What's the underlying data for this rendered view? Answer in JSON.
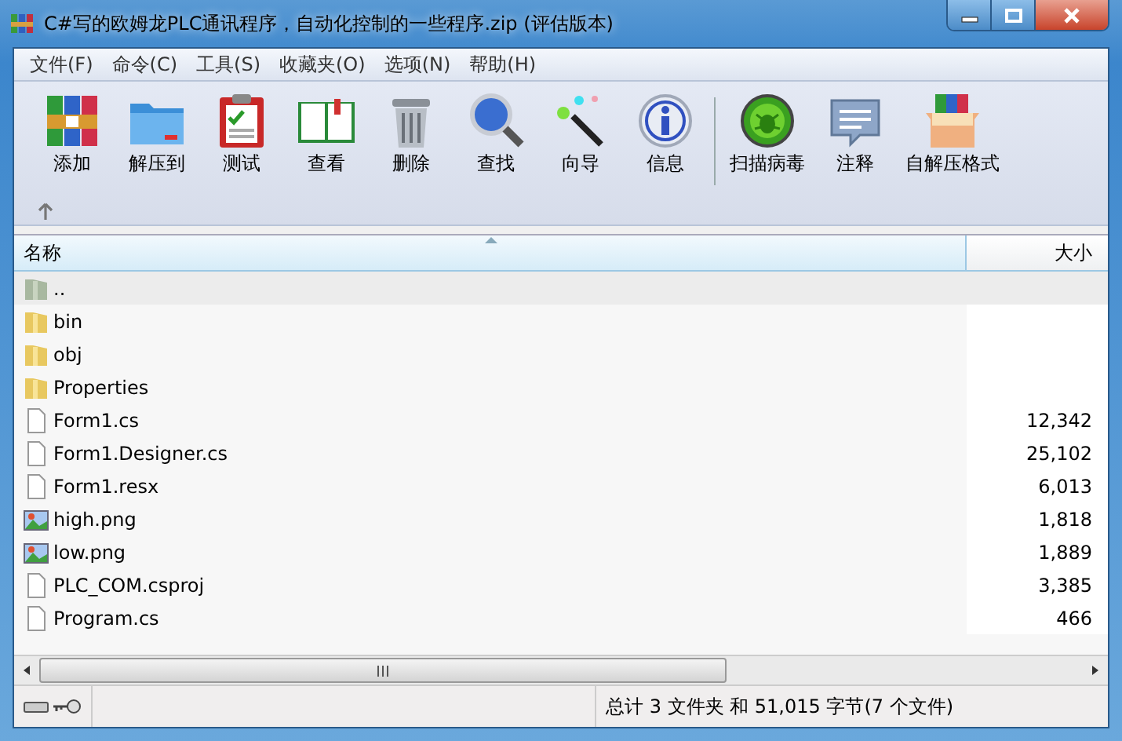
{
  "window": {
    "title": "C#写的欧姆龙PLC通讯程序，自动化控制的一些程序.zip (评估版本)"
  },
  "menu": [
    "文件(F)",
    "命令(C)",
    "工具(S)",
    "收藏夹(O)",
    "选项(N)",
    "帮助(H)"
  ],
  "toolbar": [
    {
      "label": "添加",
      "kind": "add"
    },
    {
      "label": "解压到",
      "kind": "extract"
    },
    {
      "label": "测试",
      "kind": "test"
    },
    {
      "label": "查看",
      "kind": "view"
    },
    {
      "label": "删除",
      "kind": "delete"
    },
    {
      "label": "查找",
      "kind": "find"
    },
    {
      "label": "向导",
      "kind": "wizard"
    },
    {
      "label": "信息",
      "kind": "info"
    },
    {
      "kind": "separator"
    },
    {
      "label": "扫描病毒",
      "kind": "virus"
    },
    {
      "label": "注释",
      "kind": "comment"
    },
    {
      "label": "自解压格式",
      "kind": "sfx"
    }
  ],
  "columns": [
    "名称",
    "大小"
  ],
  "rows": [
    {
      "name": "..",
      "kind": "parent",
      "selected": true
    },
    {
      "name": "bin",
      "kind": "folder",
      "selected": false
    },
    {
      "name": "obj",
      "kind": "folder",
      "selected": false
    },
    {
      "name": "Properties",
      "kind": "folder",
      "selected": false
    },
    {
      "name": "Form1.cs",
      "kind": "file",
      "size": "12,342",
      "selected": false
    },
    {
      "name": "Form1.Designer.cs",
      "kind": "file",
      "size": "25,102",
      "selected": false
    },
    {
      "name": "Form1.resx",
      "kind": "file",
      "size": "6,013",
      "selected": false
    },
    {
      "name": "high.png",
      "kind": "image",
      "size": "1,818",
      "selected": false
    },
    {
      "name": "low.png",
      "kind": "image",
      "size": "1,889",
      "selected": false
    },
    {
      "name": "PLC_COM.csproj",
      "kind": "file",
      "size": "3,385",
      "selected": false
    },
    {
      "name": "Program.cs",
      "kind": "file",
      "size": "466",
      "selected": false
    }
  ],
  "status_bar": "总计 3 文件夹 和 51,015 字节(7 个文件)"
}
